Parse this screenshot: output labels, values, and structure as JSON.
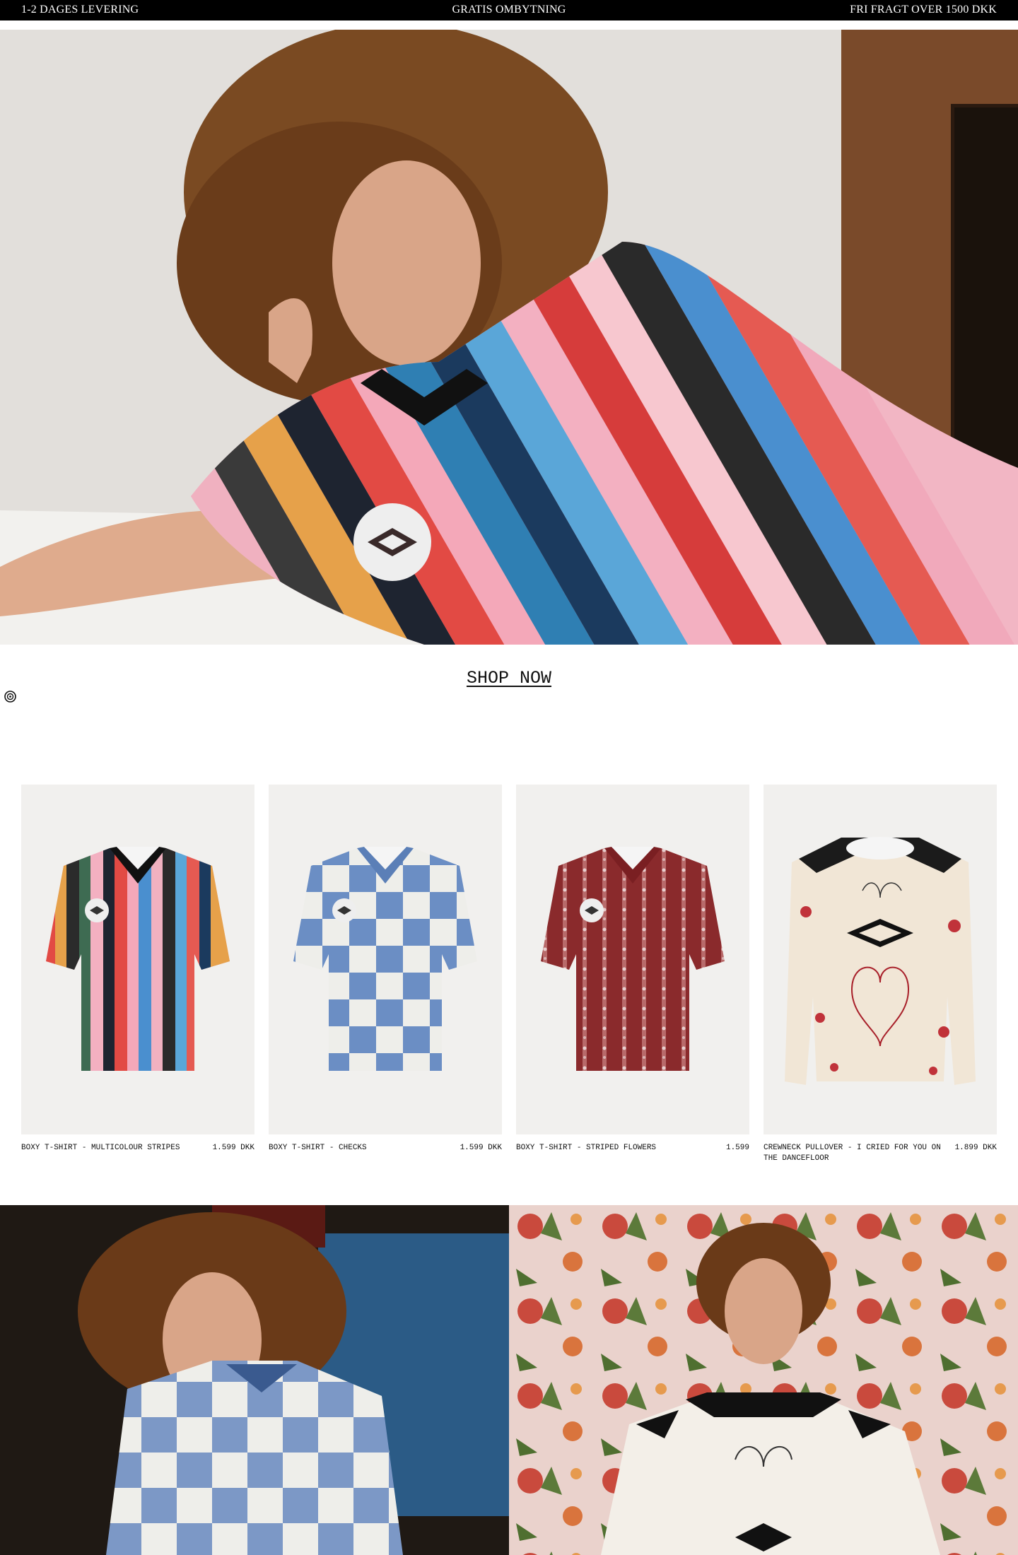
{
  "announcement": {
    "left": "1-2 DAGES LEVERING",
    "center": "GRATIS OMBYTNING",
    "right": "FRI FRAGT OVER 1500 DKK"
  },
  "hero": {
    "cta": "SHOP NOW"
  },
  "products": [
    {
      "name": "BOXY T-SHIRT - MULTICOLOUR STRIPES",
      "price": "1.599 DKK"
    },
    {
      "name": "BOXY T-SHIRT - CHECKS",
      "price": "1.599 DKK"
    },
    {
      "name": "BOXY T-SHIRT - STRIPED FLOWERS",
      "price": "1.599"
    },
    {
      "name": "CREWNECK PULLOVER - I CRIED FOR YOU ON THE DANCEFLOOR",
      "price": "1.899 DKK"
    }
  ],
  "icons": {
    "accessibility": "accessibility-icon"
  },
  "colors": {
    "announcement_bg": "#000000",
    "announcement_text": "#ffffff",
    "card_bg": "#f1f0ee"
  }
}
